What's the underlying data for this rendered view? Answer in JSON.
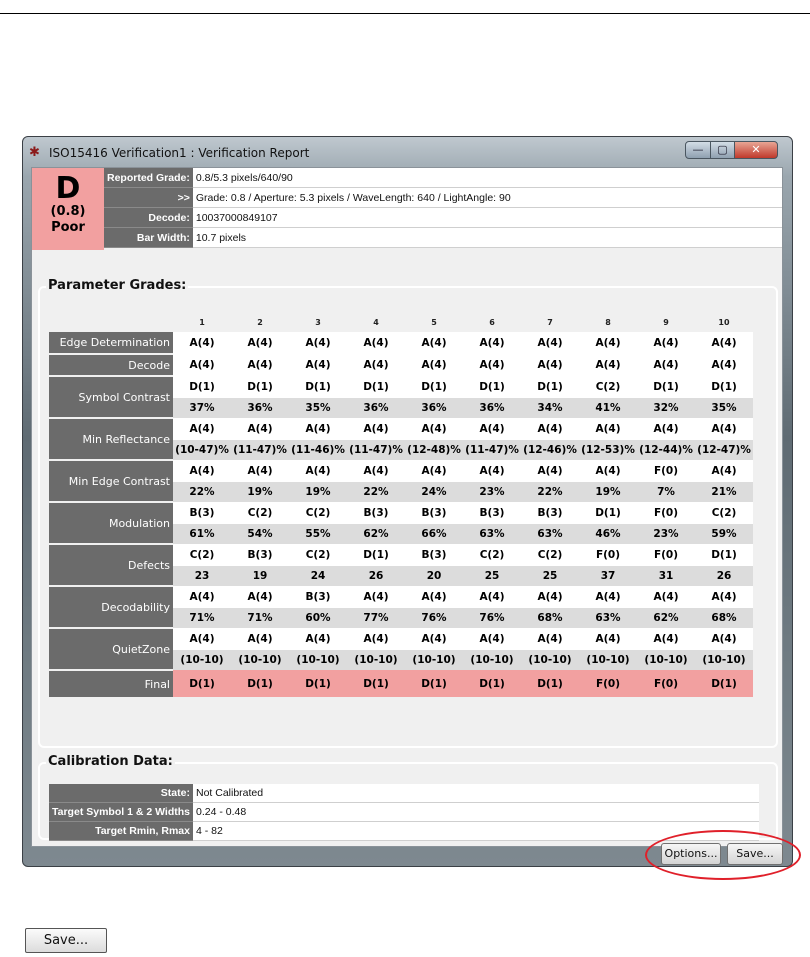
{
  "window": {
    "title": "ISO15416 Verification1 : Verification Report",
    "icon": "app-bug-icon",
    "controls": {
      "minimize": "—",
      "maximize": "▢",
      "close": "✕"
    }
  },
  "grade": {
    "letter": "D",
    "value": "(0.8)",
    "word": "Poor",
    "color": "#f2a0a0"
  },
  "info": [
    {
      "label": "Reported Grade:",
      "value": "0.8/5.3 pixels/640/90"
    },
    {
      "label": ">>",
      "value": "Grade: 0.8 / Aperture: 5.3 pixels / WaveLength: 640 / LightAngle: 90"
    },
    {
      "label": "Decode:",
      "value": "10037000849107"
    },
    {
      "label": "Bar Width:",
      "value": "10.7 pixels"
    }
  ],
  "parameter_grades": {
    "title": "Parameter Grades:",
    "columns": [
      "1",
      "2",
      "3",
      "4",
      "5",
      "6",
      "7",
      "8",
      "9",
      "10"
    ],
    "rows": [
      {
        "name": "Edge Determination",
        "grades": [
          "A(4)",
          "A(4)",
          "A(4)",
          "A(4)",
          "A(4)",
          "A(4)",
          "A(4)",
          "A(4)",
          "A(4)",
          "A(4)"
        ]
      },
      {
        "name": "Decode",
        "grades": [
          "A(4)",
          "A(4)",
          "A(4)",
          "A(4)",
          "A(4)",
          "A(4)",
          "A(4)",
          "A(4)",
          "A(4)",
          "A(4)"
        ]
      },
      {
        "name": "Symbol Contrast",
        "grades": [
          "D(1)",
          "D(1)",
          "D(1)",
          "D(1)",
          "D(1)",
          "D(1)",
          "D(1)",
          "C(2)",
          "D(1)",
          "D(1)"
        ],
        "values": [
          "37%",
          "36%",
          "35%",
          "36%",
          "36%",
          "36%",
          "34%",
          "41%",
          "32%",
          "35%"
        ]
      },
      {
        "name": "Min Reflectance",
        "grades": [
          "A(4)",
          "A(4)",
          "A(4)",
          "A(4)",
          "A(4)",
          "A(4)",
          "A(4)",
          "A(4)",
          "A(4)",
          "A(4)"
        ],
        "values": [
          "(10-47)%",
          "(11-47)%",
          "(11-46)%",
          "(11-47)%",
          "(12-48)%",
          "(11-47)%",
          "(12-46)%",
          "(12-53)%",
          "(12-44)%",
          "(12-47)%"
        ]
      },
      {
        "name": "Min Edge Contrast",
        "grades": [
          "A(4)",
          "A(4)",
          "A(4)",
          "A(4)",
          "A(4)",
          "A(4)",
          "A(4)",
          "A(4)",
          "F(0)",
          "A(4)"
        ],
        "values": [
          "22%",
          "19%",
          "19%",
          "22%",
          "24%",
          "23%",
          "22%",
          "19%",
          "7%",
          "21%"
        ]
      },
      {
        "name": "Modulation",
        "grades": [
          "B(3)",
          "C(2)",
          "C(2)",
          "B(3)",
          "B(3)",
          "B(3)",
          "B(3)",
          "D(1)",
          "F(0)",
          "C(2)"
        ],
        "values": [
          "61%",
          "54%",
          "55%",
          "62%",
          "66%",
          "63%",
          "63%",
          "46%",
          "23%",
          "59%"
        ]
      },
      {
        "name": "Defects",
        "grades": [
          "C(2)",
          "B(3)",
          "C(2)",
          "D(1)",
          "B(3)",
          "C(2)",
          "C(2)",
          "F(0)",
          "F(0)",
          "D(1)"
        ],
        "values": [
          "23",
          "19",
          "24",
          "26",
          "20",
          "25",
          "25",
          "37",
          "31",
          "26"
        ]
      },
      {
        "name": "Decodability",
        "grades": [
          "A(4)",
          "A(4)",
          "B(3)",
          "A(4)",
          "A(4)",
          "A(4)",
          "A(4)",
          "A(4)",
          "A(4)",
          "A(4)"
        ],
        "values": [
          "71%",
          "71%",
          "60%",
          "77%",
          "76%",
          "76%",
          "68%",
          "63%",
          "62%",
          "68%"
        ]
      },
      {
        "name": "QuietZone",
        "grades": [
          "A(4)",
          "A(4)",
          "A(4)",
          "A(4)",
          "A(4)",
          "A(4)",
          "A(4)",
          "A(4)",
          "A(4)",
          "A(4)"
        ],
        "values": [
          "(10-10)",
          "(10-10)",
          "(10-10)",
          "(10-10)",
          "(10-10)",
          "(10-10)",
          "(10-10)",
          "(10-10)",
          "(10-10)",
          "(10-10)"
        ]
      }
    ],
    "final": {
      "name": "Final",
      "grades": [
        "D(1)",
        "D(1)",
        "D(1)",
        "D(1)",
        "D(1)",
        "D(1)",
        "D(1)",
        "F(0)",
        "F(0)",
        "D(1)"
      ]
    }
  },
  "calibration": {
    "title": "Calibration Data:",
    "rows": [
      {
        "label": "State:",
        "value": "Not Calibrated"
      },
      {
        "label": "Target Symbol 1 & 2 Widths",
        "value": "0.24 - 0.48"
      },
      {
        "label": "Target Rmin, Rmax",
        "value": "4 - 82"
      }
    ]
  },
  "buttons": {
    "options": "Options...",
    "save": "Save..."
  },
  "standalone_button": {
    "label": "Save..."
  },
  "colors": {
    "header_cell": "#6b6b6b",
    "final_row": "#f2a0a0",
    "highlight": "#e0202a"
  }
}
